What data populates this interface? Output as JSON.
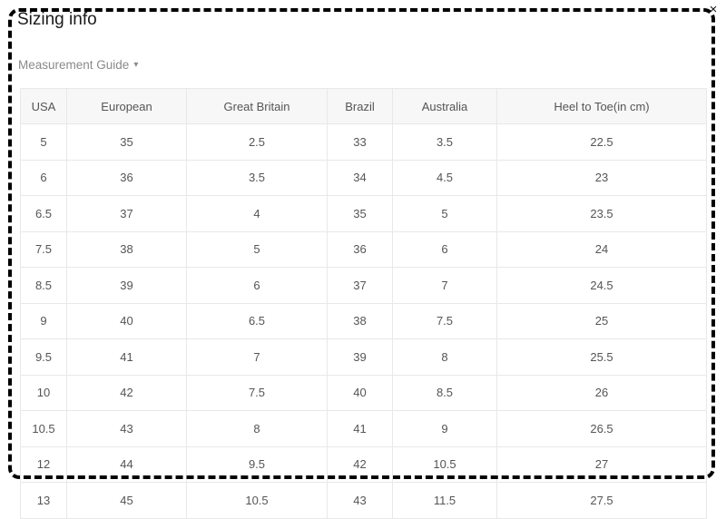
{
  "panel": {
    "title": "Sizing info",
    "close_icon": "close-icon",
    "close_label": "×"
  },
  "guide": {
    "label": "Measurement Guide",
    "caret_icon": "chevron-down-icon",
    "caret_glyph": "▾"
  },
  "colors": {
    "header_background": "#f7f7f7",
    "border": "#e8e8e8",
    "text": "#555555",
    "title_text": "#1a1a1a",
    "muted_text": "#8a8a8a",
    "frame": "#000000"
  },
  "table": {
    "headers": [
      "USA",
      "European",
      "Great Britain",
      "Brazil",
      "Australia",
      "Heel to Toe(in cm)"
    ],
    "rows": [
      [
        "5",
        "35",
        "2.5",
        "33",
        "3.5",
        "22.5"
      ],
      [
        "6",
        "36",
        "3.5",
        "34",
        "4.5",
        "23"
      ],
      [
        "6.5",
        "37",
        "4",
        "35",
        "5",
        "23.5"
      ],
      [
        "7.5",
        "38",
        "5",
        "36",
        "6",
        "24"
      ],
      [
        "8.5",
        "39",
        "6",
        "37",
        "7",
        "24.5"
      ],
      [
        "9",
        "40",
        "6.5",
        "38",
        "7.5",
        "25"
      ],
      [
        "9.5",
        "41",
        "7",
        "39",
        "8",
        "25.5"
      ],
      [
        "10",
        "42",
        "7.5",
        "40",
        "8.5",
        "26"
      ],
      [
        "10.5",
        "43",
        "8",
        "41",
        "9",
        "26.5"
      ],
      [
        "12",
        "44",
        "9.5",
        "42",
        "10.5",
        "27"
      ],
      [
        "13",
        "45",
        "10.5",
        "43",
        "11.5",
        "27.5"
      ]
    ]
  }
}
